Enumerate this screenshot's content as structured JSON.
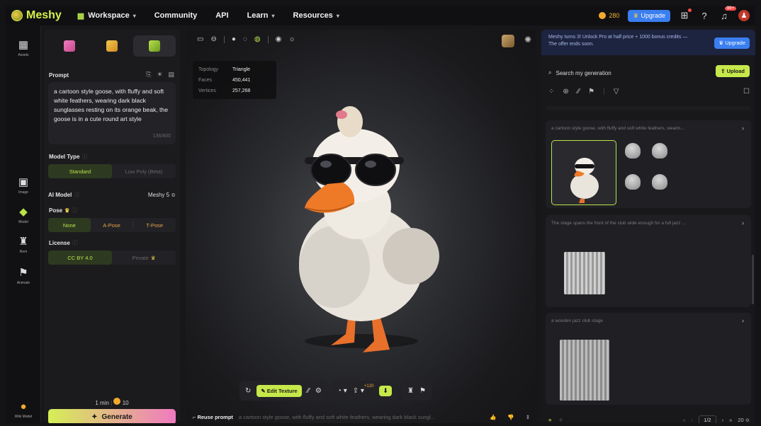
{
  "topbar": {
    "brand": "Meshy",
    "nav": [
      {
        "label": "Workspace",
        "has_menu": true
      },
      {
        "label": "Community",
        "has_menu": false
      },
      {
        "label": "API",
        "has_menu": false
      },
      {
        "label": "Learn",
        "has_menu": true
      },
      {
        "label": "Resources",
        "has_menu": true
      }
    ],
    "credits": "280",
    "upgrade_label": "Upgrade",
    "notif_badge": "99+"
  },
  "rail": {
    "items": [
      {
        "label": "Assets",
        "icon": "grid-icon",
        "glyph": "▦"
      },
      {
        "label": "Image",
        "icon": "image-plus-icon",
        "glyph": "▣"
      },
      {
        "label": "Model",
        "icon": "cube-icon",
        "glyph": "◆"
      },
      {
        "label": "Rem",
        "icon": "statue-icon",
        "glyph": "♜"
      },
      {
        "label": "Animate",
        "icon": "running-figure-icon",
        "glyph": "🏃"
      }
    ],
    "bottom_label": "Wiki Model"
  },
  "left_panel": {
    "prompt_label": "Prompt",
    "prompt_text": "a cartoon style goose, with fluffy and soft white feathers, wearing dark black sunglasses resting on its orange beak, the goose is in a cute round art style",
    "prompt_count": "136/800",
    "model_type_label": "Model Type",
    "model_types": [
      "Standard",
      "Low Poly (Beta)"
    ],
    "ai_model_label": "AI Model",
    "ai_model_value": "Meshy 5 ≎",
    "pose_label": "Pose",
    "poses": [
      "None",
      "A-Pose",
      "T-Pose"
    ],
    "license_label": "License",
    "licenses": [
      "CC BY 4.0",
      "Private"
    ],
    "time_label": "1 min",
    "cost": "10",
    "generate_label": "Generate"
  },
  "viewport": {
    "stats": [
      {
        "k": "Topology",
        "v": "Triangle"
      },
      {
        "k": "Faces",
        "v": "450,441"
      },
      {
        "k": "Vertices",
        "v": "257,268"
      }
    ],
    "edit_texture_label": "Edit Texture",
    "export_badge": "+120",
    "reuse_label": "Reuse prompt",
    "reuse_prompt": "a cartoon style goose, with fluffy and soft white feathers, wearing dark black sungl..."
  },
  "right_panel": {
    "promo_text": "Meshy turns 3! Unlock Pro at half price + 1000 bonus credits — The offer ends soon.",
    "promo_upgrade": "Upgrade",
    "search_placeholder": "Search my generation",
    "upload_label": "Upload",
    "cards": [
      {
        "title": "a cartoon style goose, with fluffy and soft white feathers, wearin..."
      },
      {
        "title": "The stage spans the front of the club wide enough for a full jazz ..."
      },
      {
        "title": "a wooden jazz club stage"
      }
    ],
    "page_current": "1/2",
    "per_page": "20 ≎"
  }
}
